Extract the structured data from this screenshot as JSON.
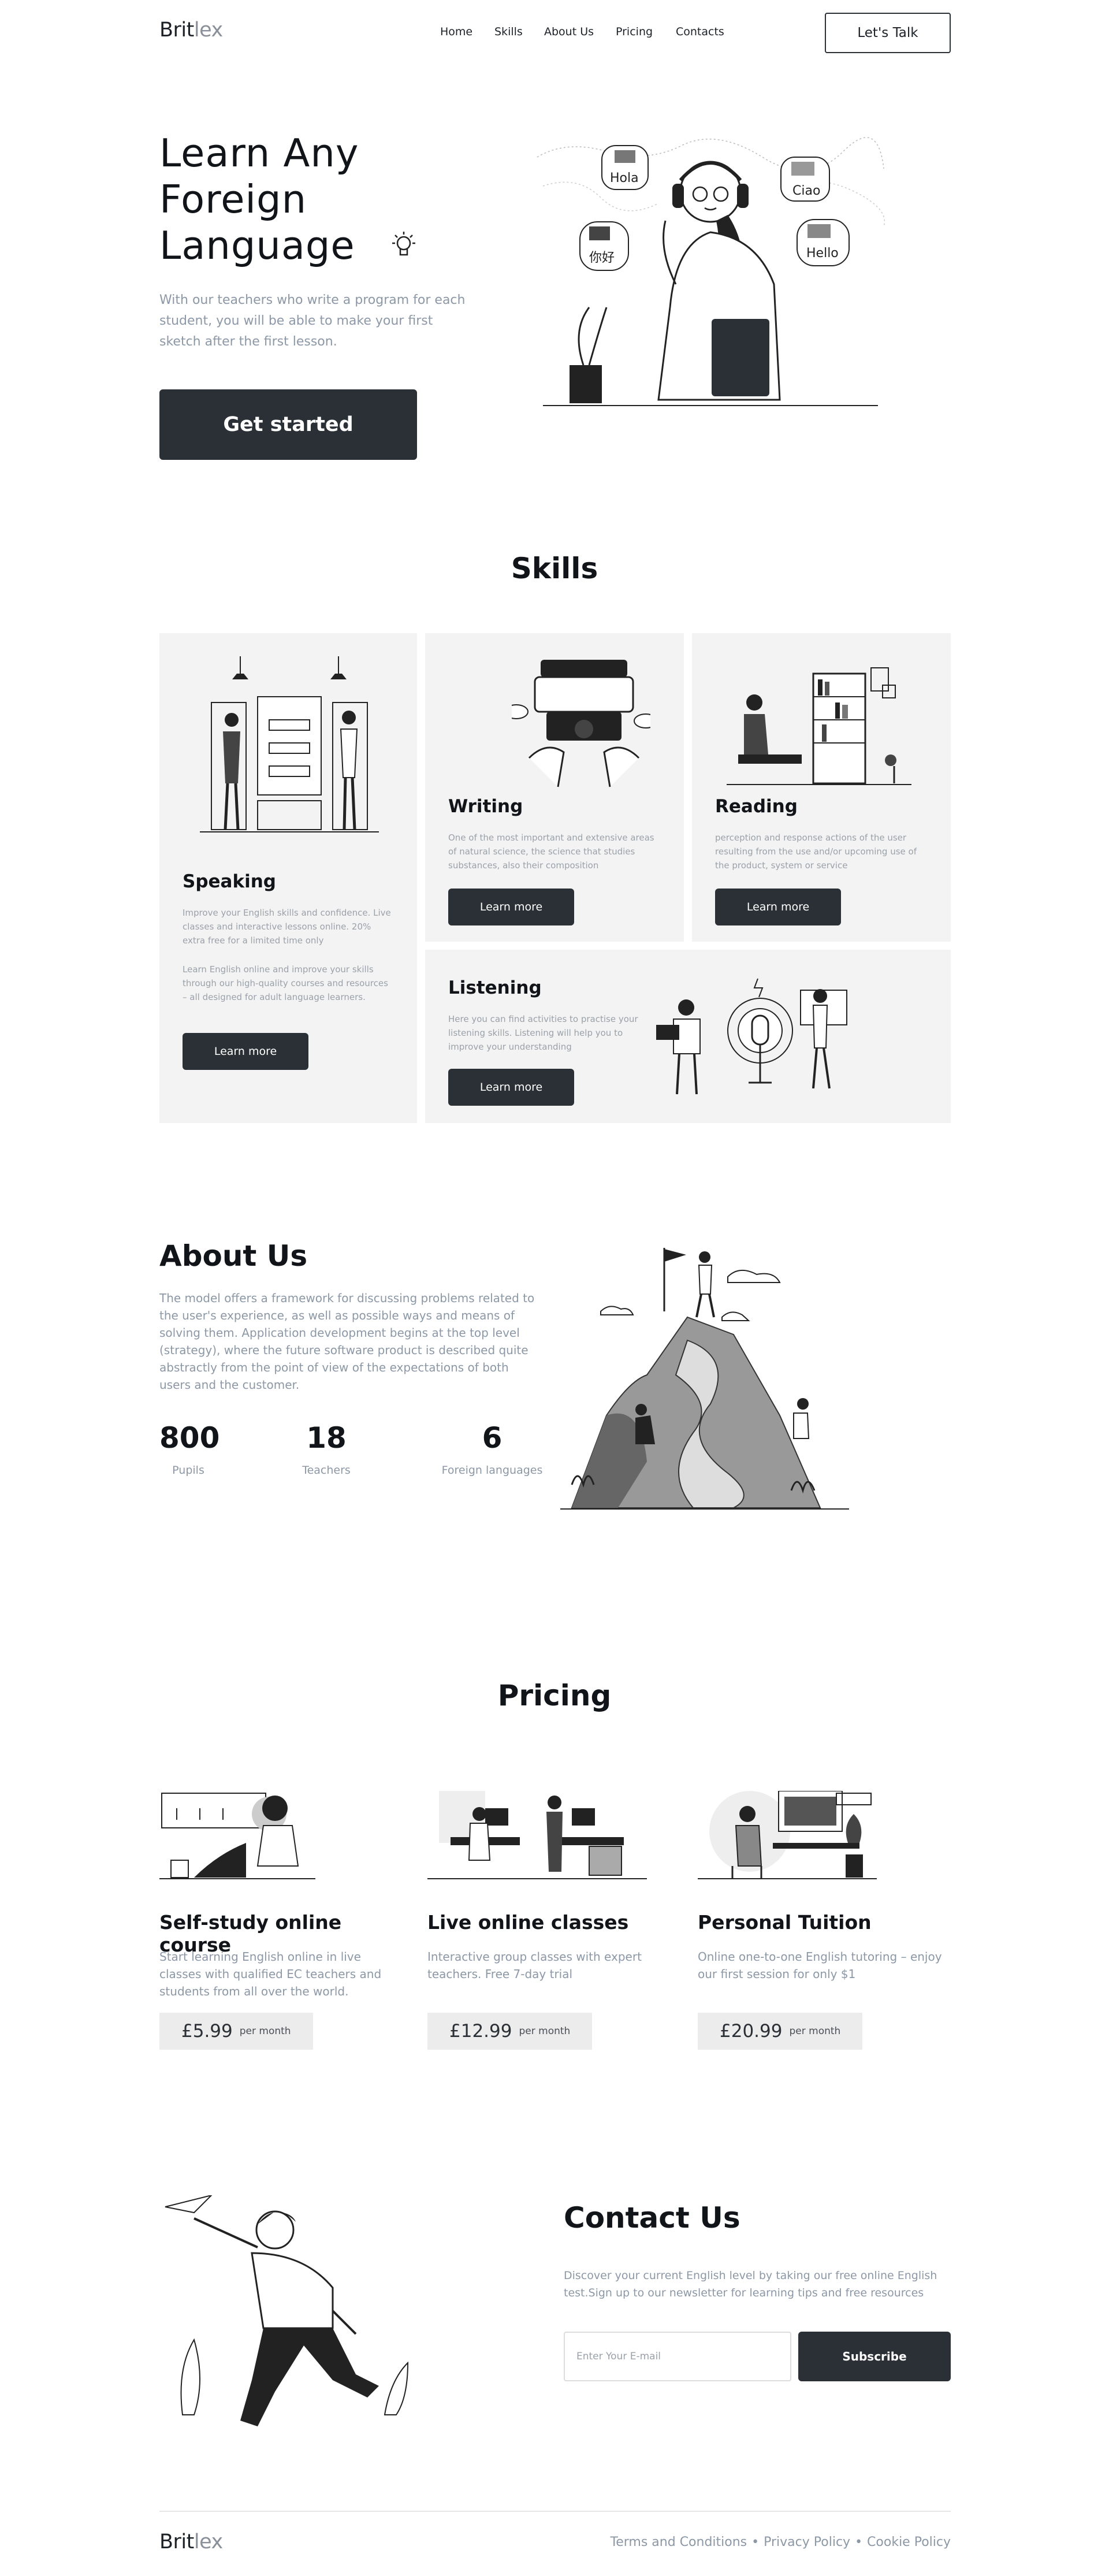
{
  "header": {
    "logo_main": "Brit",
    "logo_light": "lex",
    "nav": [
      "Home",
      "Skills",
      "About Us",
      "Pricing",
      "Contacts"
    ],
    "cta": "Let's Talk"
  },
  "hero": {
    "title_line1": "Learn Any",
    "title_line2": "Foreign",
    "title_line3": "Language",
    "subtitle": "With our teachers who write a program for each student, you will be able to make your first sketch after the first lesson.",
    "button": "Get started",
    "bubbles": [
      "Hola",
      "Ciao",
      "你好",
      "Hello"
    ]
  },
  "skills": {
    "title": "Skills",
    "speaking": {
      "title": "Speaking",
      "text1": "Improve your English skills and confidence. Live classes and interactive lessons online. 20% extra free for a limited time only",
      "text2": "Learn English online and improve your skills through our high-quality courses and resources – all designed for adult language learners.",
      "button": "Learn more"
    },
    "writing": {
      "title": "Writing",
      "text": "One of the most important and extensive areas of natural science, the science that studies substances, also their composition",
      "button": "Learn more"
    },
    "reading": {
      "title": "Reading",
      "text": "perception and response actions of the user resulting from the use and/or upcoming use of the product, system or service",
      "button": "Learn more"
    },
    "listening": {
      "title": "Listening",
      "text": "Here you can find activities to practise your listening skills. Listening will help you to improve your understanding",
      "button": "Learn more"
    }
  },
  "about": {
    "title": "About Us",
    "text": "The model offers a framework for discussing problems related to the user's experience, as well as possible ways and means of solving them. Application development begins at the top level (strategy), where the future software product is described quite abstractly from the point of view of the expectations of both users and the customer.",
    "stats": [
      {
        "value": "800",
        "label": "Pupils"
      },
      {
        "value": "18",
        "label": "Teachers"
      },
      {
        "value": "6",
        "label": "Foreign languages"
      }
    ]
  },
  "pricing": {
    "title": "Pricing",
    "plans": [
      {
        "title": "Self-study online course",
        "text": "Start learning English online in live classes with qualified EC teachers and students from all over the world.",
        "price": "£5.99",
        "period": "per month"
      },
      {
        "title": "Live online classes",
        "text": "Interactive group classes with expert teachers. Free 7-day trial",
        "price": "£12.99",
        "period": "per month"
      },
      {
        "title": "Personal Tuition",
        "text": "Online one-to-one English tutoring – enjoy our first session for only $1",
        "price": "£20.99",
        "period": "per month"
      }
    ]
  },
  "contact": {
    "title": "Contact Us",
    "text": "Discover your current English level by taking our free online English test.Sign up to our newsletter for learning tips and free resources",
    "email_placeholder": "Enter Your E-mail",
    "button": "Subscribe"
  },
  "footer": {
    "logo_main": "Brit",
    "logo_light": "lex",
    "links": [
      "Terms and Conditions",
      "Privacy Policy",
      "Cookie Policy"
    ],
    "separator": "•"
  }
}
